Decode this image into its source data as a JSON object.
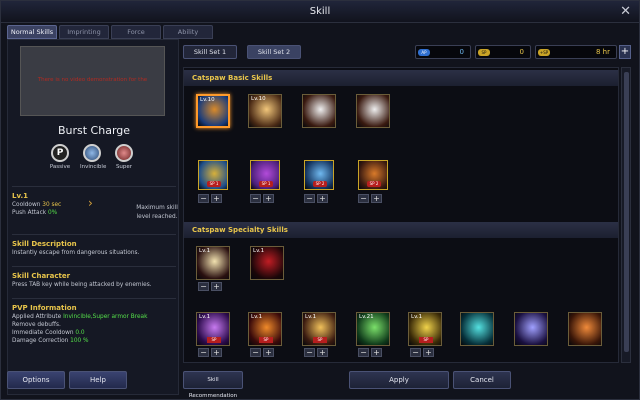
{
  "window": {
    "title": "Skill",
    "close_glyph": "✕"
  },
  "tabs": [
    {
      "label": "Normal Skills",
      "active": true
    },
    {
      "label": "Imprinting",
      "active": false
    },
    {
      "label": "Force",
      "active": false
    },
    {
      "label": "Ability",
      "active": false
    }
  ],
  "left": {
    "video_text": "There is no video demonstration for the",
    "skill_name": "Burst Charge",
    "attributes": [
      {
        "icon": "passive-icon",
        "glyph": "P",
        "label": "Passive"
      },
      {
        "icon": "invincible-icon",
        "glyph": "",
        "label": "Invincible"
      },
      {
        "icon": "super-icon",
        "glyph": "",
        "label": "Super"
      }
    ],
    "level": "Lv.1",
    "cooldown_label": "Cooldown",
    "cooldown_value": "30 sec",
    "push_attack_label": "Push Attack",
    "push_attack_value": "0%",
    "max_level_text_1": "Maximum skill",
    "max_level_text_2": "level reached.",
    "desc_header": "Skill Description",
    "desc_text": "Instantly escape from dangerous situations.",
    "char_header": "Skill Character",
    "char_text": "Press TAB key while being attacked by enemies.",
    "pvp_header": "PVP Information",
    "pvp_applied_label": "Applied Attribute",
    "pvp_applied_value": "Invincible,Super armor Break",
    "pvp_remove": "Remove debuffs.",
    "pvp_cooldown_label": "Immediate Cooldown",
    "pvp_cooldown_value": "0.0",
    "pvp_damage_label": "Damage Correction",
    "pvp_damage_value": "100 %",
    "options_label": "Options",
    "help_label": "Help"
  },
  "right": {
    "skill_set_1": "Skill Set 1",
    "skill_set_2": "Skill Set 2",
    "ap_badge": "AP",
    "ap_value": "0",
    "sp_badge": "SP",
    "sp_value": "0",
    "time_badge": "+SP",
    "time_value": "8 hr",
    "plus": "+",
    "basic_header": "Catspaw Basic Skills",
    "specialty_header": "Catspaw Specialty Skills",
    "basic_icons": [
      {
        "level": "Lv.10",
        "colors": [
          "#1b3c7a",
          "#d98a2a"
        ]
      },
      {
        "level": "Lv.10",
        "colors": [
          "#4a2a15",
          "#f1c67a"
        ]
      },
      {
        "level": "",
        "colors": [
          "#3a1a10",
          "#eeeeee"
        ]
      },
      {
        "level": "",
        "colors": [
          "#3a1a10",
          "#eeeeee"
        ]
      }
    ],
    "basic_mods": [
      {
        "label": "SP 1",
        "colors": [
          "#1f4f8a",
          "#d7b03a"
        ]
      },
      {
        "label": "SP 1",
        "colors": [
          "#4a1f7a",
          "#b24bd9"
        ]
      },
      {
        "label": "SP 2",
        "colors": [
          "#12305a",
          "#6fb8ef"
        ]
      },
      {
        "label": "SP 2",
        "colors": [
          "#3a1a10",
          "#d97a2a"
        ]
      }
    ],
    "spec_row1": [
      {
        "level": "Lv.1",
        "colors": [
          "#2a1010",
          "#f2e2b0"
        ]
      },
      {
        "level": "Lv.1",
        "colors": [
          "#1a0608",
          "#c01d24"
        ]
      }
    ],
    "spec_row2": [
      {
        "level": "Lv.1",
        "colors": [
          "#2a0a4a",
          "#c77af0"
        ],
        "sp": "SP"
      },
      {
        "level": "Lv.1",
        "colors": [
          "#3a0a0a",
          "#f08a2a"
        ],
        "sp": "SP"
      },
      {
        "level": "Lv.1",
        "colors": [
          "#3a1a10",
          "#f0c05a"
        ],
        "sp": "SP"
      },
      {
        "level": "Lv.21",
        "colors": [
          "#0f3a1a",
          "#7be06a"
        ],
        "sp": ""
      },
      {
        "level": "Lv.1",
        "colors": [
          "#3a2a08",
          "#f0d24a"
        ],
        "sp": "SP"
      },
      {
        "level": "",
        "colors": [
          "#06303a",
          "#54e0e0"
        ],
        "sp": ""
      },
      {
        "level": "",
        "colors": [
          "#1a1040",
          "#a0a0ff"
        ],
        "sp": ""
      },
      {
        "level": "",
        "colors": [
          "#3a1608",
          "#f08a3a"
        ],
        "sp": ""
      }
    ],
    "recommendation_label": "Skill Recommendation",
    "apply_label": "Apply",
    "cancel_label": "Cancel"
  },
  "colors": {
    "accent": "#e8c54b",
    "positive": "#55e04a",
    "selected": "#ff9a2b"
  }
}
